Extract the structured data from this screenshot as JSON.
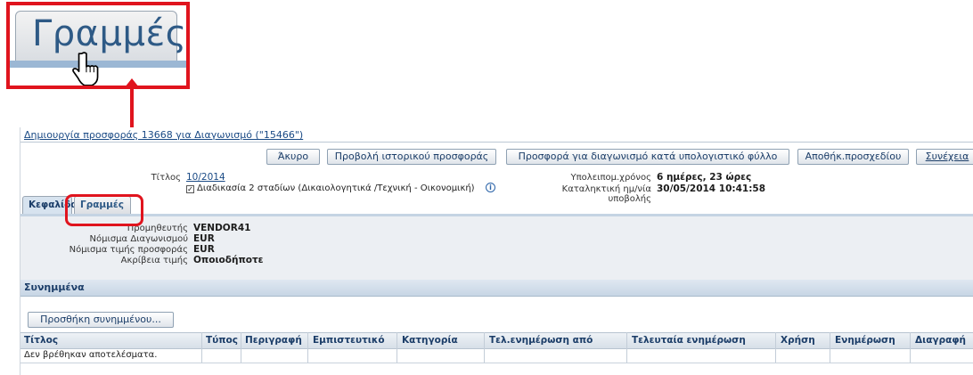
{
  "zoom": {
    "tab_label": "Γραμμές",
    "cursor_icon": "hand-pointer-icon",
    "highlight_color": "#e0141e"
  },
  "page": {
    "title": "Δημιουργία προσφοράς 13668 για Διαγωνισμό (\"15466\")"
  },
  "toolbar": {
    "cancel": "Άκυρο",
    "history": "Προβολή ιστορικού προσφοράς",
    "spreadsheet": "Προσφορά για διαγωνισμό κατά υπολογιστικό φύλλο",
    "save_draft": "Αποθήκ.προσχεδίου",
    "continue": "Συνέχεια"
  },
  "info": {
    "title_label": "Τίτλος",
    "title_value": "10/2014",
    "two_stage": "Διαδικασία 2 σταδίων (Δικαιολογητικά /Τεχνική - Οικονομική)",
    "remaining_label": "Υπολειπομ.χρόνος",
    "remaining_value": "6 ημέρες, 23 ώρες",
    "deadline_label": "Καταληκτική ημ/νία υποβολής",
    "deadline_value": "30/05/2014 10:41:58"
  },
  "tabs": {
    "header": "Κεφαλίδα",
    "lines": "Γραμμές"
  },
  "header": {
    "supplier_label": "Προμηθευτής",
    "supplier_value": "VENDOR41",
    "currency_label": "Νόμισμα Διαγωνισμού",
    "currency_value": "EUR",
    "bid_currency_label": "Νόμισμα τιμής προσφοράς",
    "bid_currency_value": "EUR",
    "precision_label": "Ακρίβεια τιμής",
    "precision_value": "Οποιοδήποτε"
  },
  "attachments": {
    "section_title": "Συνημμένα",
    "add_button": "Προσθήκη συνημμένου...",
    "columns": [
      "Τίτλος",
      "Τύπος",
      "Περιγραφή",
      "Εμπιστευτικό",
      "Κατηγορία",
      "Τελ.ενημέρωση από",
      "Τελευταία ενημέρωση",
      "Χρήση",
      "Ενημέρωση",
      "Διαγραφή"
    ],
    "empty_text": "Δεν βρέθηκαν αποτελέσματα."
  }
}
